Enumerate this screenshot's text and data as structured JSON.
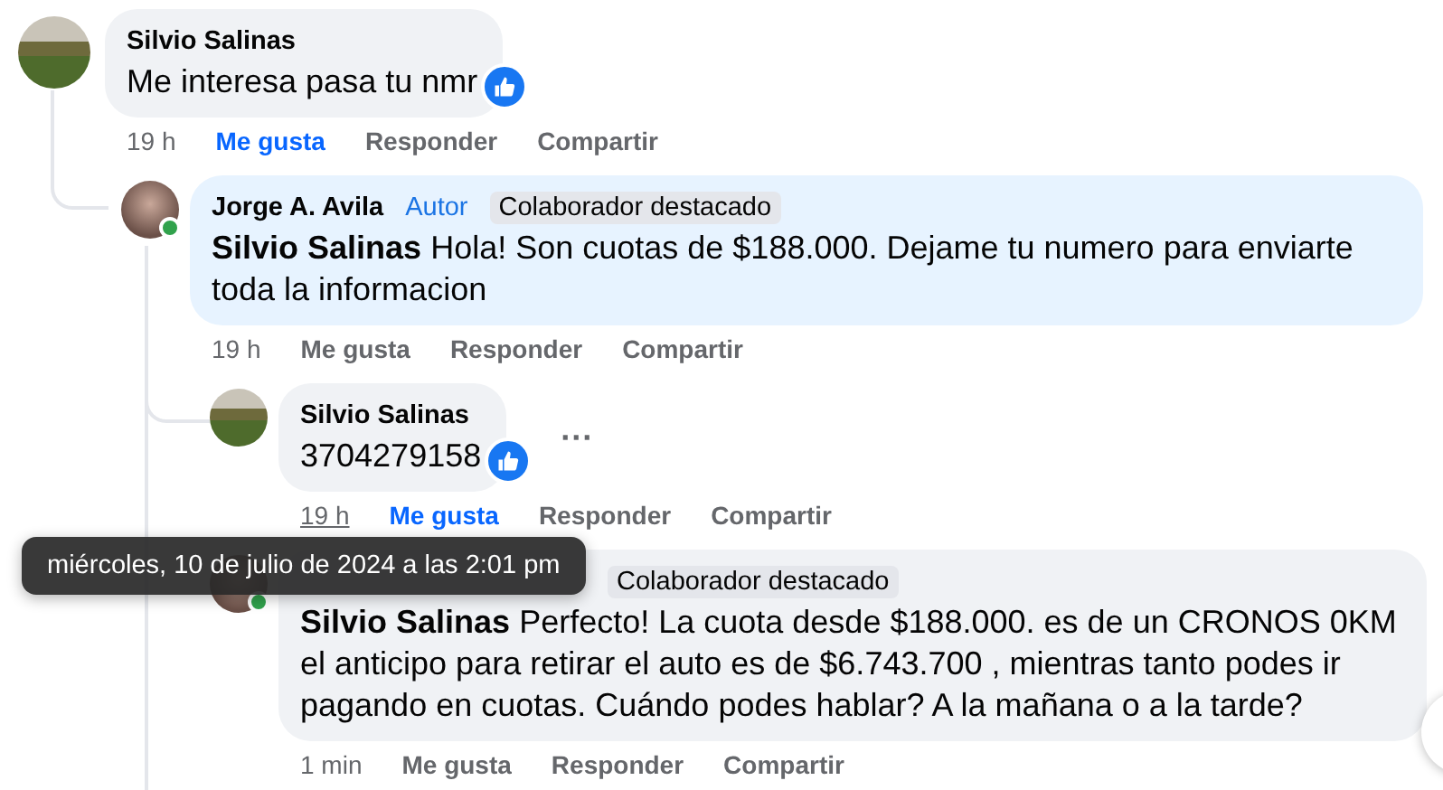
{
  "comments": [
    {
      "author": "Silvio Salinas",
      "online": false,
      "text": "Me interesa pasa tu nmr",
      "reacted": true,
      "time": "19 h",
      "time_hovered": false,
      "like_label": "Me gusta",
      "liked": true,
      "reply_label": "Responder",
      "share_label": "Compartir",
      "children": [
        {
          "author": "Jorge A. Avila",
          "online": true,
          "badges": [
            {
              "kind": "author",
              "label": "Autor"
            },
            {
              "kind": "contributor",
              "label": "Colaborador destacado"
            }
          ],
          "text": "**Silvio Salinas** Hola! Son cuotas de $188.000. Dejame tu numero para enviarte toda la informacion",
          "reacted": false,
          "time": "19 h",
          "time_hovered": false,
          "like_label": "Me gusta",
          "liked": false,
          "reply_label": "Responder",
          "share_label": "Compartir",
          "children": [
            {
              "author": "Silvio Salinas",
              "online": false,
              "text": "3704279158",
              "reacted": true,
              "more_label": "···",
              "time": "19 h",
              "time_hovered": true,
              "like_label": "Me gusta",
              "liked": true,
              "reply_label": "Responder",
              "share_label": "Compartir"
            },
            {
              "online": true,
              "badges": [
                {
                  "kind": "contributor",
                  "label": "Colaborador destacado"
                }
              ],
              "text": "**Silvio Salinas** Perfecto! La cuota desde $188.000. es de un CRONOS 0KM el anticipo para retirar el auto es de $6.743.700 , mientras tanto podes ir pagando en cuotas. Cuándo podes hablar? A la mañana o a la tarde?",
              "reacted": false,
              "time": "1 min",
              "time_hovered": false,
              "like_label": "Me gusta",
              "liked": false,
              "reply_label": "Responder",
              "share_label": "Compartir"
            }
          ]
        }
      ]
    }
  ],
  "tooltip": {
    "text": "miércoles, 10 de julio de 2024 a las 2:01 pm"
  }
}
